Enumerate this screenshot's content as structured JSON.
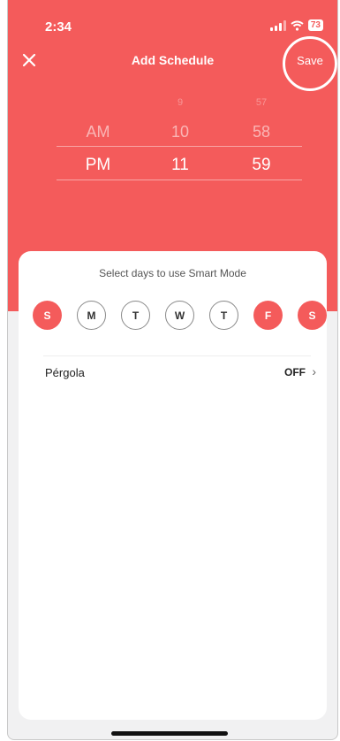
{
  "status_bar": {
    "time": "2:34",
    "battery": "73"
  },
  "header": {
    "title": "Add Schedule",
    "save_label": "Save"
  },
  "time_picker": {
    "period": {
      "above": "AM",
      "selected": "PM"
    },
    "hour": {
      "faint": "9",
      "above": "10",
      "selected": "11"
    },
    "minute": {
      "faint": "57",
      "above": "58",
      "selected": "59"
    }
  },
  "days_card": {
    "title": "Select days to use Smart Mode",
    "days": [
      {
        "letter": "S",
        "selected": true
      },
      {
        "letter": "M",
        "selected": false
      },
      {
        "letter": "T",
        "selected": false
      },
      {
        "letter": "W",
        "selected": false
      },
      {
        "letter": "T",
        "selected": false
      },
      {
        "letter": "F",
        "selected": true
      },
      {
        "letter": "S",
        "selected": true
      }
    ]
  },
  "devices": [
    {
      "name": "Pérgola",
      "state": "OFF"
    }
  ],
  "colors": {
    "accent": "#f45b5b",
    "background": "#f1f1f2",
    "card": "#ffffff"
  }
}
